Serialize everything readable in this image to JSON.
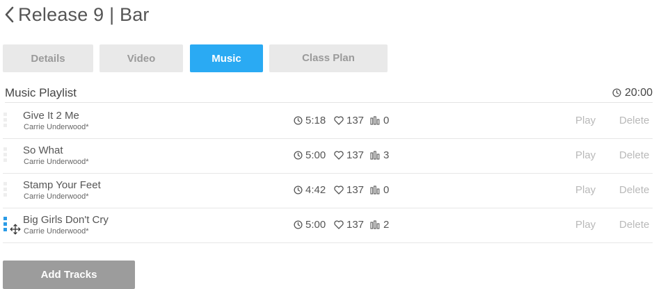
{
  "header": {
    "title": "Release 9 | Bar"
  },
  "tabs": [
    {
      "label": "Details"
    },
    {
      "label": "Video"
    },
    {
      "label": "Music"
    },
    {
      "label": "Class Plan"
    }
  ],
  "playlist": {
    "title": "Music Playlist",
    "total_duration": "20:00",
    "play_label": "Play",
    "delete_label": "Delete",
    "tracks": [
      {
        "name": "Give It 2 Me",
        "artist": "Carrie Underwood*",
        "duration": "5:18",
        "likes": "137",
        "plays": "0"
      },
      {
        "name": "So What",
        "artist": "Carrie Underwood*",
        "duration": "5:00",
        "likes": "137",
        "plays": "3"
      },
      {
        "name": "Stamp Your Feet",
        "artist": "Carrie Underwood*",
        "duration": "4:42",
        "likes": "137",
        "plays": "0"
      },
      {
        "name": "Big Girls Don't Cry",
        "artist": "Carrie Underwood*",
        "duration": "5:00",
        "likes": "137",
        "plays": "2"
      }
    ]
  },
  "footer": {
    "add_tracks_label": "Add Tracks"
  },
  "colors": {
    "accent": "#2aaaf3",
    "tab_bg": "#e9e9e9",
    "button_gray": "#9c9c9c",
    "drag_handle_active": "#2a9be6"
  },
  "icons": {
    "back": "chevron-left-icon",
    "clock": "clock-icon",
    "heart": "heart-icon",
    "bars": "bar-chart-icon",
    "move": "move-arrows-icon"
  }
}
